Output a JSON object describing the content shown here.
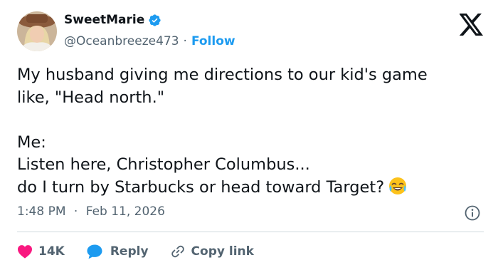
{
  "author": {
    "display_name": "SweetMarie",
    "handle": "@Oceanbreeze473",
    "separator": "·",
    "follow_label": "Follow"
  },
  "tweet": {
    "lines": [
      "My husband giving me directions to our kid's game",
      "like, \"Head north.\"",
      "",
      "Me:",
      "Listen here, Christopher Columbus...",
      "do I turn by Starbucks or head toward Target?"
    ],
    "emoji": "joy-face-emoji"
  },
  "meta": {
    "time": "1:48 PM",
    "separator": "·",
    "date": "Feb 11, 2026"
  },
  "actions": {
    "like_count": "14K",
    "reply_label": "Reply",
    "copy_link_label": "Copy link"
  },
  "colors": {
    "accent": "#1d9bf0",
    "like": "#f91880",
    "text": "#0f1419",
    "secondary": "#536471",
    "divider": "#cfd9de"
  },
  "icons": [
    "verified-badge-icon",
    "x-logo-icon",
    "info-icon",
    "heart-icon",
    "reply-bubble-icon",
    "link-icon"
  ]
}
